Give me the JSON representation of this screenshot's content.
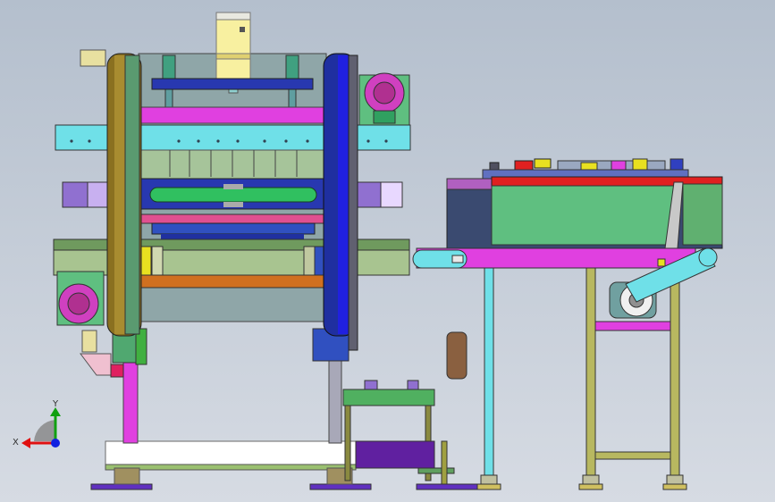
{
  "viewport": {
    "background_top": "#b4bfcd",
    "background_bottom": "#d6dbe3"
  },
  "triad": {
    "x_label": "X",
    "y_label": "Y",
    "x_color": "#e01010",
    "y_color": "#10a010",
    "z_color": "#1020e0"
  },
  "palette": {
    "cyan_beam": "#6fe0e8",
    "magenta": "#e040e0",
    "green_body": "#5fbf80",
    "olive_green": "#a8c490",
    "dark_blue": "#1f2fa0",
    "lavender": "#b090e0",
    "red_strip": "#e02020",
    "yellow_pad": "#e8e020"
  }
}
